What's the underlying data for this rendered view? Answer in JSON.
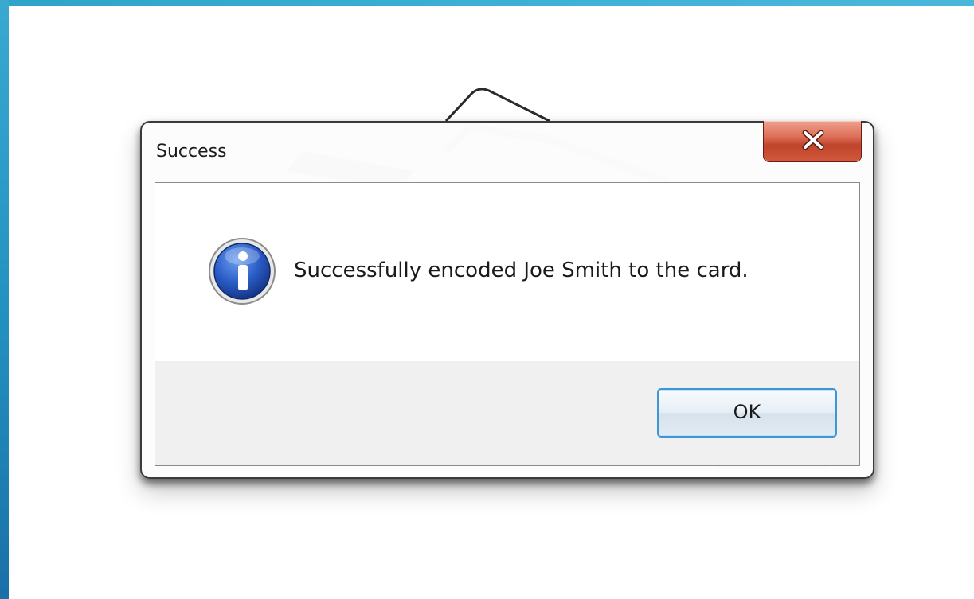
{
  "window": {
    "title": "Success",
    "close_icon": "close-icon"
  },
  "message": {
    "icon": "info-icon",
    "text": "Successfully encoded Joe Smith to the card."
  },
  "buttons": {
    "ok_label": "OK"
  },
  "colors": {
    "accent_bar": "#2290bf",
    "close_button": "#c0442b",
    "info_icon": "#1f4fb0",
    "ok_button_border": "#3d96d6"
  }
}
